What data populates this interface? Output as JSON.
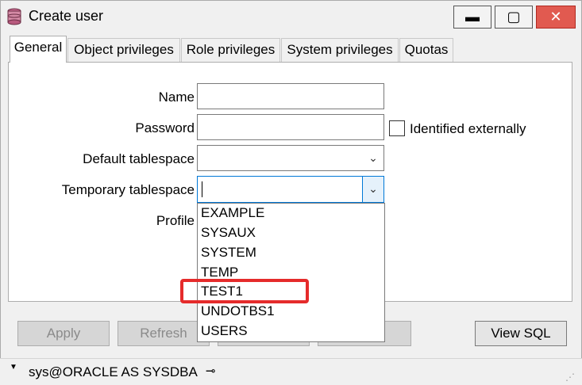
{
  "window": {
    "title": "Create user"
  },
  "tabs": [
    {
      "label": "General"
    },
    {
      "label": "Object privileges"
    },
    {
      "label": "Role privileges"
    },
    {
      "label": "System privileges"
    },
    {
      "label": "Quotas"
    }
  ],
  "form": {
    "name_label": "Name",
    "name_value": "",
    "password_label": "Password",
    "password_value": "",
    "identified_externally_label": "Identified externally",
    "default_tablespace_label": "Default tablespace",
    "temporary_tablespace_label": "Temporary tablespace",
    "profile_label": "Profile"
  },
  "dropdown": {
    "options": [
      "EXAMPLE",
      "SYSAUX",
      "SYSTEM",
      "TEMP",
      "TEST1",
      "UNDOTBS1",
      "USERS"
    ],
    "highlighted": "TEST1"
  },
  "buttons": {
    "apply": "Apply",
    "refresh": "Refresh",
    "view_sql": "View SQL"
  },
  "status": {
    "connection": "sys@ORACLE AS SYSDBA"
  },
  "colors": {
    "highlight": "#e52b2b",
    "close_button": "#e15a50"
  }
}
